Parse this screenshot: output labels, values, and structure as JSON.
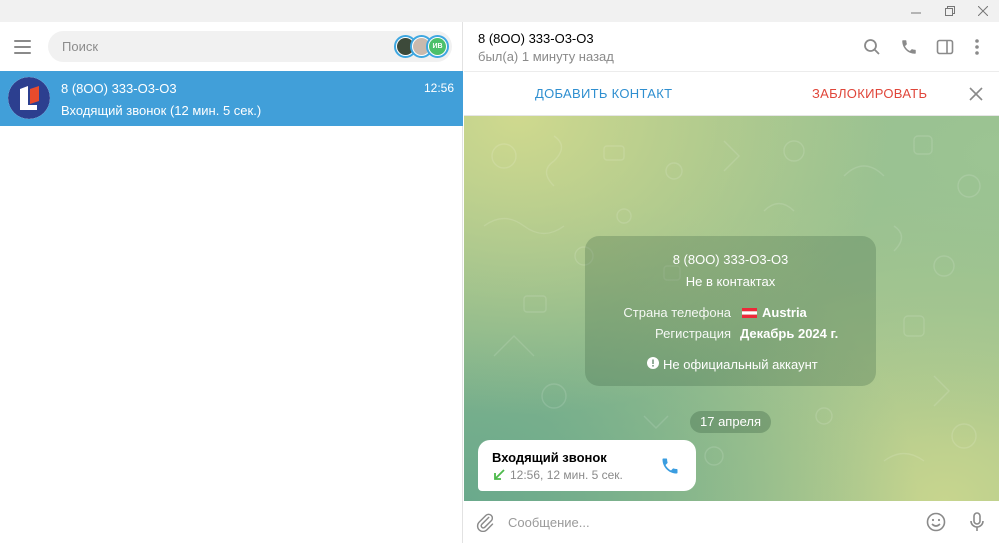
{
  "colors": {
    "accent": "#419fd9",
    "action_add": "#2f8fd0",
    "action_block": "#e0463a",
    "call_icon": "#3a9de0",
    "incoming_arrow": "#4cb94a"
  },
  "sidebar": {
    "search_placeholder": "Поиск",
    "stories": [
      {
        "icon": "story-avatar-1"
      },
      {
        "icon": "story-avatar-2"
      },
      {
        "label": "ИВ",
        "color": "#4cc06a"
      }
    ]
  },
  "chat_list": [
    {
      "name": "8 (8OO) 333-O3-O3",
      "time": "12:56",
      "preview": "Входящий звонок (12 мин. 5 сек.)",
      "selected": true
    }
  ],
  "header": {
    "title": "8 (8OO) 333-O3-O3",
    "status": "был(а) 1 минуту назад"
  },
  "action_bar": {
    "add_contact": "ДОБАВИТЬ КОНТАКТ",
    "block": "ЗАБЛОКИРОВАТЬ"
  },
  "info_card": {
    "name": "8 (8OO) 333-O3-O3",
    "subtitle": "Не в контактах",
    "country_label": "Страна телефона",
    "country_value": "Austria",
    "registration_label": "Регистрация",
    "registration_value": "Декабрь 2024 г.",
    "warning": "Не официальный аккаунт"
  },
  "date_separator": "17 апреля",
  "message": {
    "title": "Входящий звонок",
    "details": "12:56, 12 мин. 5 сек."
  },
  "composer": {
    "placeholder": "Сообщение..."
  }
}
